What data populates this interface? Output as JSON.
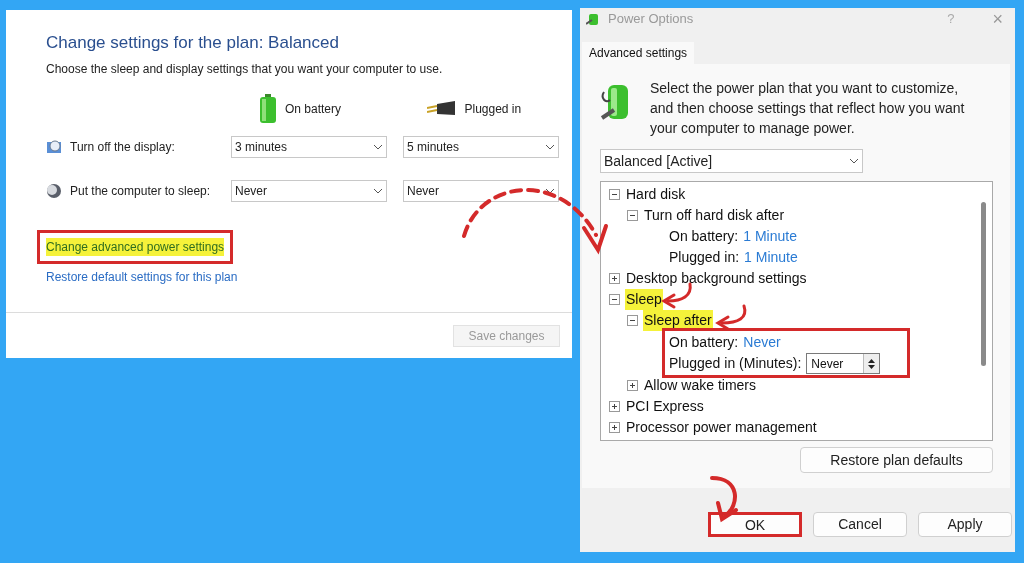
{
  "plan_window": {
    "title": "Change settings for the plan: Balanced",
    "subtitle": "Choose the sleep and display settings that you want your computer to use.",
    "columns": [
      {
        "kind": "battery",
        "label": "On battery"
      },
      {
        "kind": "plug",
        "label": "Plugged in"
      }
    ],
    "rows": [
      {
        "kind": "display",
        "label": "Turn off the display:",
        "values": [
          "3 minutes",
          "5 minutes"
        ]
      },
      {
        "kind": "sleep",
        "label": "Put the computer to sleep:",
        "values": [
          "Never",
          "Never"
        ]
      }
    ],
    "links": [
      {
        "label": "Change advanced power settings",
        "highlighted": true,
        "boxed": true
      },
      {
        "label": "Restore default settings for this plan",
        "highlighted": false,
        "boxed": false
      }
    ],
    "save_button": {
      "label": "Save changes",
      "disabled": true
    }
  },
  "power_options": {
    "title": "Power Options",
    "help": "?",
    "close": "×",
    "tab": {
      "label": "Advanced settings",
      "selected": true
    },
    "description": "Select the power plan that you want to customize, and then choose settings that reflect how you want your computer to manage power.",
    "plan": "Balanced [Active]",
    "tree": [
      {
        "label": "Hard disk",
        "expanded": true,
        "highlighted": false,
        "children": [
          {
            "label": "Turn off hard disk after",
            "expanded": true,
            "highlighted": false,
            "boxed": false,
            "settings": [
              {
                "label": "On battery:",
                "value": "1 Minute",
                "kind": "link"
              },
              {
                "label": "Plugged in:",
                "value": "1 Minute",
                "kind": "link"
              }
            ]
          }
        ]
      },
      {
        "label": "Desktop background settings",
        "expanded": false,
        "highlighted": false
      },
      {
        "label": "Sleep",
        "expanded": true,
        "highlighted": true,
        "children": [
          {
            "label": "Sleep after",
            "expanded": true,
            "highlighted": true,
            "boxed": true,
            "settings": [
              {
                "label": "On battery:",
                "value": "Never",
                "kind": "link"
              },
              {
                "label": "Plugged in (Minutes):",
                "value": "Never",
                "kind": "spin"
              }
            ]
          },
          {
            "label": "Allow wake timers",
            "expanded": false,
            "highlighted": false
          }
        ]
      },
      {
        "label": "PCI Express",
        "expanded": false,
        "highlighted": false
      },
      {
        "label": "Processor power management",
        "expanded": false,
        "highlighted": false
      }
    ],
    "restore_button": "Restore plan defaults",
    "buttons": [
      {
        "label": "OK",
        "boxed": true
      },
      {
        "label": "Cancel",
        "boxed": false
      },
      {
        "label": "Apply",
        "boxed": false
      }
    ]
  }
}
